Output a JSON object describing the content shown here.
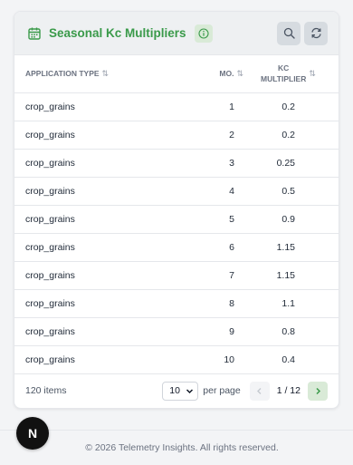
{
  "header": {
    "title": "Seasonal Kc Multipliers",
    "icon": "calendar-icon",
    "accent_color": "#3a9a4a"
  },
  "table": {
    "columns": [
      {
        "label": "APPLICATION TYPE",
        "sort": "⇅"
      },
      {
        "label": "MO.",
        "sort": "⇅"
      },
      {
        "label_line1": "KC",
        "label_line2": "MULTIPLIER",
        "sort": "⇅"
      }
    ],
    "rows": [
      {
        "type": "crop_grains",
        "mo": "1",
        "kc": "0.2"
      },
      {
        "type": "crop_grains",
        "mo": "2",
        "kc": "0.2"
      },
      {
        "type": "crop_grains",
        "mo": "3",
        "kc": "0.25"
      },
      {
        "type": "crop_grains",
        "mo": "4",
        "kc": "0.5"
      },
      {
        "type": "crop_grains",
        "mo": "5",
        "kc": "0.9"
      },
      {
        "type": "crop_grains",
        "mo": "6",
        "kc": "1.15"
      },
      {
        "type": "crop_grains",
        "mo": "7",
        "kc": "1.15"
      },
      {
        "type": "crop_grains",
        "mo": "8",
        "kc": "1.1"
      },
      {
        "type": "crop_grains",
        "mo": "9",
        "kc": "0.8"
      },
      {
        "type": "crop_grains",
        "mo": "10",
        "kc": "0.4"
      }
    ]
  },
  "footer": {
    "items_count": "120 items",
    "per_page_value": "10",
    "per_page_label": "per page",
    "page_indicator": "1 / 12"
  },
  "site": {
    "copyright": "© 2026 Telemetry Insights. All rights reserved.",
    "badge_letter": "N"
  }
}
